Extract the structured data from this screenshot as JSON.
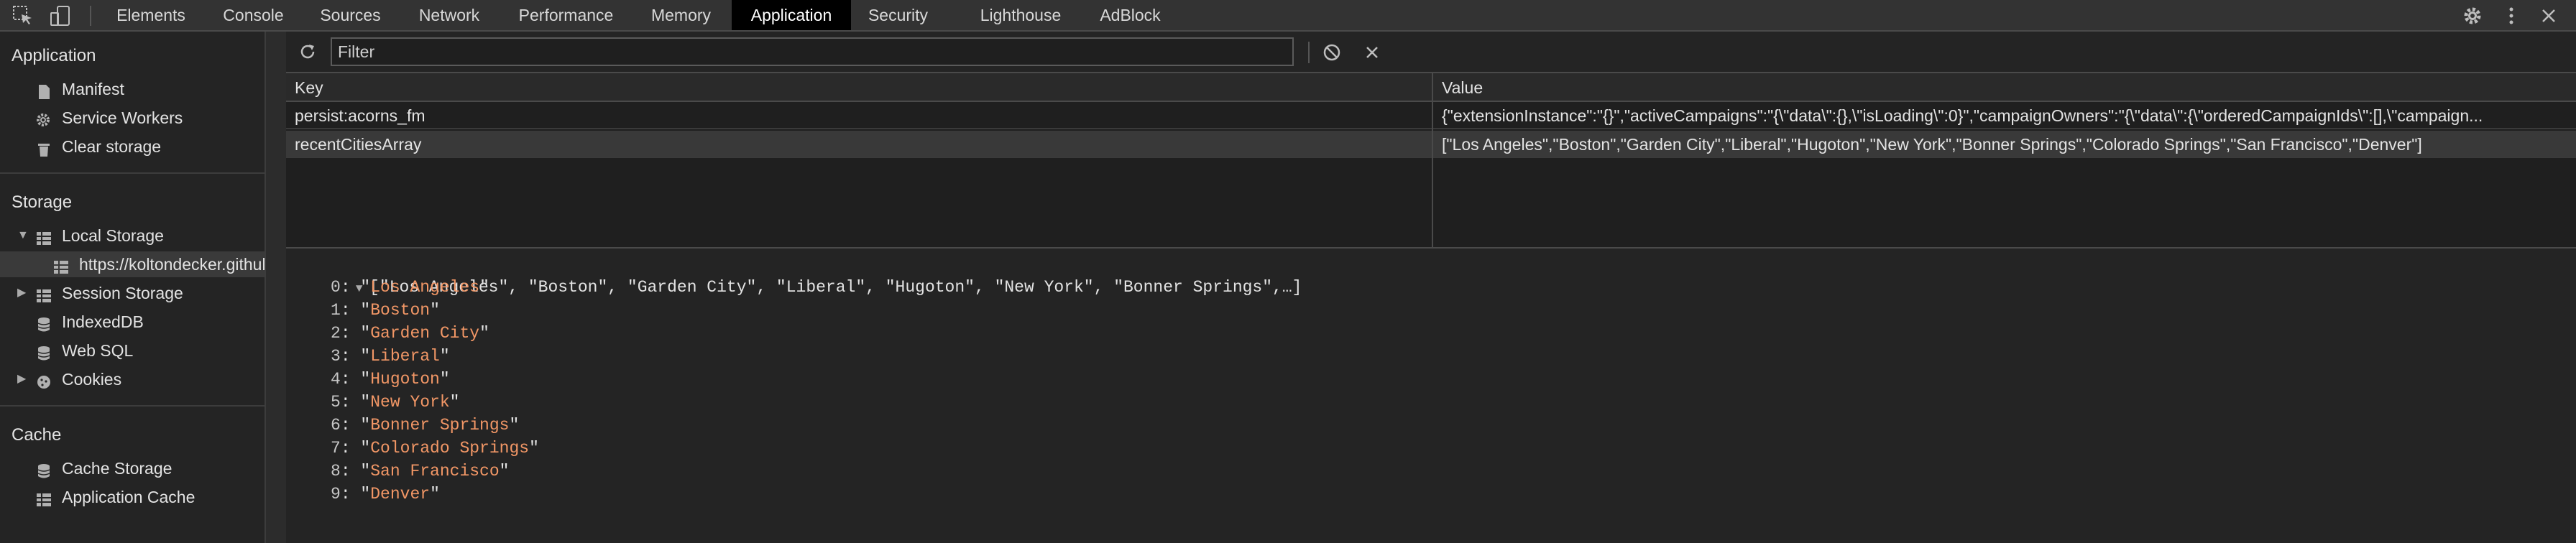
{
  "toolbar": {
    "tabs": [
      "Elements",
      "Console",
      "Sources",
      "Network",
      "Performance",
      "Memory",
      "Application",
      "Security",
      "Lighthouse",
      "AdBlock"
    ],
    "active_tab": "Application",
    "icons": [
      "inspect-element-icon",
      "device-toggle-icon",
      "settings-gear-icon",
      "more-options-icon",
      "close-icon"
    ]
  },
  "sidebar": {
    "application": {
      "title": "Application",
      "items": [
        "Manifest",
        "Service Workers",
        "Clear storage"
      ]
    },
    "storage": {
      "title": "Storage",
      "local_storage": "Local Storage",
      "local_storage_origin": "https://koltondecker.github.io",
      "session_storage": "Session Storage",
      "indexeddb": "IndexedDB",
      "websql": "Web SQL",
      "cookies": "Cookies"
    },
    "cache": {
      "title": "Cache",
      "items": [
        "Cache Storage",
        "Application Cache"
      ]
    }
  },
  "filter": {
    "placeholder": "Filter"
  },
  "grid": {
    "headers": {
      "key": "Key",
      "value": "Value"
    },
    "rows": [
      {
        "key": "persist:acorns_fm",
        "value": "{\"extensionInstance\":\"{}\",\"activeCampaigns\":\"{\\\"data\\\":{},\\\"isLoading\\\":0}\",\"campaignOwners\":\"{\\\"data\\\":{\\\"orderedCampaignIds\\\":[],\\\"campaign..."
      },
      {
        "key": "recentCitiesArray",
        "value": "[\"Los Angeles\",\"Boston\",\"Garden City\",\"Liberal\",\"Hugoton\",\"New York\",\"Bonner Springs\",\"Colorado Springs\",\"San Francisco\",\"Denver\"]"
      }
    ],
    "selected_row": 1
  },
  "preview": {
    "summary": "[\"Los Angeles\", \"Boston\", \"Garden City\", \"Liberal\", \"Hugoton\", \"New York\", \"Bonner Springs\",…]",
    "entries": [
      {
        "index": "0",
        "value": "Los Angeles"
      },
      {
        "index": "1",
        "value": "Boston"
      },
      {
        "index": "2",
        "value": "Garden City"
      },
      {
        "index": "3",
        "value": "Liberal"
      },
      {
        "index": "4",
        "value": "Hugoton"
      },
      {
        "index": "5",
        "value": "New York"
      },
      {
        "index": "6",
        "value": "Bonner Springs"
      },
      {
        "index": "7",
        "value": "Colorado Springs"
      },
      {
        "index": "8",
        "value": "San Francisco"
      },
      {
        "index": "9",
        "value": "Denver"
      }
    ]
  },
  "colors": {
    "accent_string": "#f29766",
    "background": "#242424",
    "toolbar": "#333333",
    "active_tab": "#000000"
  }
}
